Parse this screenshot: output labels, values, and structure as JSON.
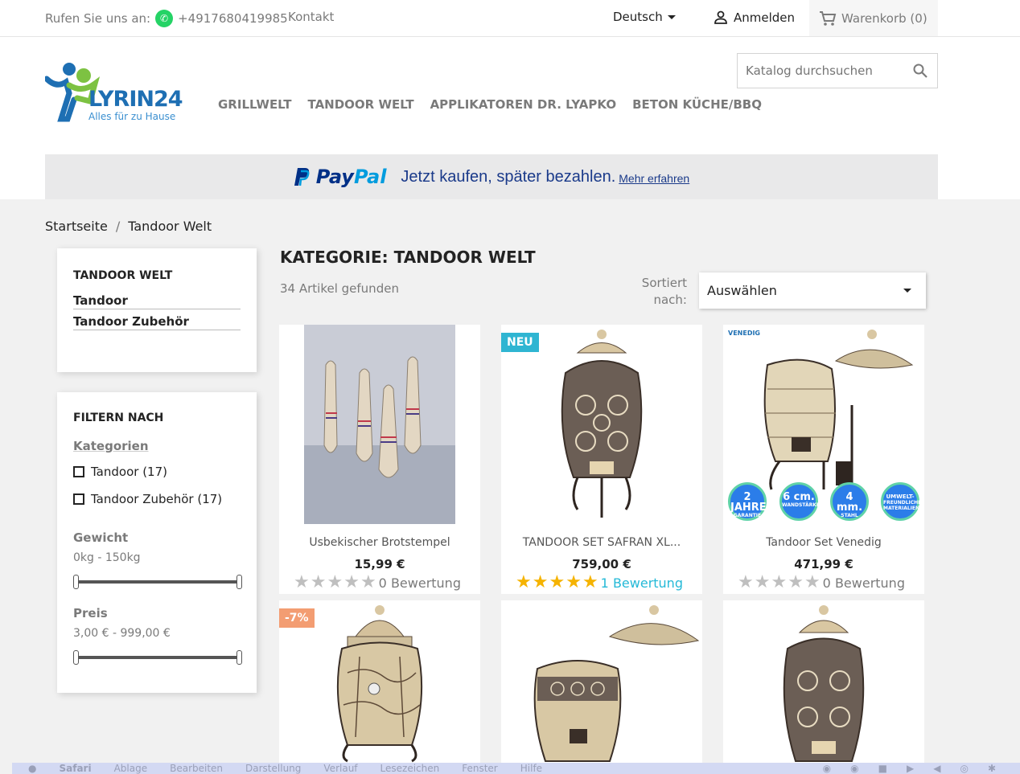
{
  "topbar": {
    "call_label": "Rufen Sie uns an:",
    "phone": "+4917680419985",
    "contact": "Kontakt",
    "language": "Deutsch",
    "login": "Anmelden",
    "cart": "Warenkorb (0)"
  },
  "header": {
    "logo_brand": "LYRIN24",
    "logo_tagline": "Alles für zu Hause",
    "menu": [
      "GRILLWELT",
      "TANDOOR WELT",
      "APPLIKATOREN DR. LYAPKO",
      "BETON KÜCHE/BBQ"
    ],
    "search_placeholder": "Katalog durchsuchen"
  },
  "paypal": {
    "pay": "Pay",
    "pal": "Pal",
    "text": "Jetzt kaufen, später bezahlen.",
    "link": "Mehr erfahren"
  },
  "breadcrumb": {
    "home": "Startseite",
    "separator": "/",
    "current": "Tandoor Welt"
  },
  "sidebar": {
    "category_title": "TANDOOR WELT",
    "category_links": [
      "Tandoor",
      "Tandoor Zubehör"
    ],
    "filter_title": "FILTERN NACH",
    "categories_label": "Kategorien",
    "checkboxes": [
      "Tandoor (17)",
      "Tandoor Zubehör (17)"
    ],
    "weight_label": "Gewicht",
    "weight_range": "0kg - 150kg",
    "price_label": "Preis",
    "price_range": "3,00 € - 999,00 €"
  },
  "content": {
    "title": "KATEGORIE: TANDOOR WELT",
    "found": "34 Artikel gefunden",
    "sort_label": "Sortiert nach:",
    "sort_value": "Auswählen"
  },
  "products": [
    {
      "name": "Usbekischer Brotstempel",
      "price": "15,99 €",
      "stars": 0,
      "rating": "0 Bewertung"
    },
    {
      "name": "TANDOOR SET SAFRAN XL...",
      "price": "759,00 €",
      "stars": 5,
      "rating": "1 Bewertung",
      "badge": "NEU"
    },
    {
      "name": "Tandoor Set Venedig",
      "price": "471,99 €",
      "stars": 0,
      "rating": "0 Bewertung",
      "label": "VENEDIG",
      "seals": [
        {
          "big": "2 JAHRE",
          "small": "GARANTIE"
        },
        {
          "big": "6 cm.",
          "small": "WANDSTÄRKE"
        },
        {
          "big": "4 mm.",
          "small": "STAHL"
        },
        {
          "big": "UMWELT-",
          "small": "FREUNDLICHE MATERIALIEN"
        }
      ]
    },
    {
      "badge": "-7%"
    },
    {},
    {}
  ],
  "os_menubar": {
    "items": [
      "Safari",
      "Ablage",
      "Bearbeiten",
      "Darstellung",
      "Verlauf",
      "Lesezeichen",
      "Fenster",
      "Hilfe"
    ]
  },
  "colors": {
    "accent": "#2fb5d2",
    "discount": "#f39d72",
    "star": "#f5b301",
    "paypal_dark": "#003087",
    "paypal_light": "#009cde"
  }
}
